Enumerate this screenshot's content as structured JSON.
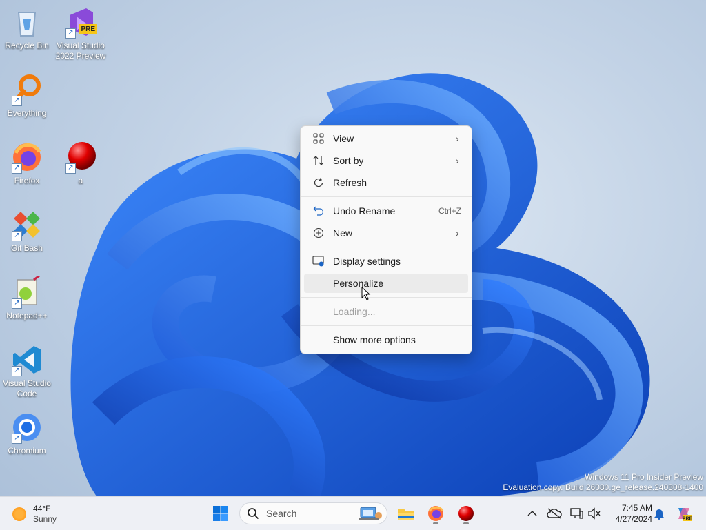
{
  "desktop": {
    "icons": [
      {
        "label": "Recycle Bin",
        "icon": "recycle-bin-icon"
      },
      {
        "label": "Visual Studio 2022 Preview",
        "icon": "visual-studio-icon",
        "badge": "PRE"
      },
      {
        "label": "Everything",
        "icon": "everything-search-icon"
      },
      {
        "label": "Firefox",
        "icon": "firefox-icon"
      },
      {
        "label": "a",
        "icon": "red-ball-icon"
      },
      {
        "label": "Git Bash",
        "icon": "git-bash-icon"
      },
      {
        "label": "Notepad++",
        "icon": "notepad-plus-plus-icon"
      },
      {
        "label": "Visual Studio Code",
        "icon": "vscode-icon"
      },
      {
        "label": "Chromium",
        "icon": "chromium-icon"
      }
    ]
  },
  "context_menu": {
    "items": [
      {
        "label": "View",
        "icon": "view-grid-icon",
        "submenu": true
      },
      {
        "label": "Sort by",
        "icon": "sort-icon",
        "submenu": true
      },
      {
        "label": "Refresh",
        "icon": "refresh-icon"
      },
      {
        "label": "Undo Rename",
        "icon": "undo-icon",
        "shortcut": "Ctrl+Z"
      },
      {
        "label": "New",
        "icon": "new-plus-icon",
        "submenu": true
      },
      {
        "label": "Display settings",
        "icon": "display-settings-icon"
      },
      {
        "label": "Personalize",
        "icon": "personalize-icon",
        "hovered": true
      },
      {
        "label": "Loading...",
        "disabled": true
      },
      {
        "label": "Show more options",
        "icon": "more-options-icon"
      }
    ]
  },
  "watermark": {
    "line1": "Windows 11 Pro Insider Preview",
    "line2": "Evaluation copy. Build 26080.ge_release.240308-1400"
  },
  "taskbar": {
    "weather": {
      "temp": "44°F",
      "condition": "Sunny"
    },
    "search_placeholder": "Search",
    "clock": {
      "time": "7:45 AM",
      "date": "4/27/2024"
    }
  },
  "colors": {
    "wallpaper_blue": "#1565e0",
    "accent": "#0067c0",
    "menu_bg": "#f9f9f9"
  }
}
